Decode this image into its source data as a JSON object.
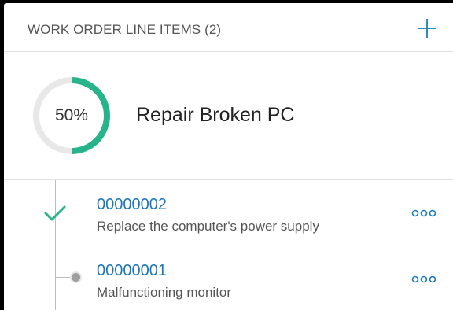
{
  "header": {
    "title": "WORK ORDER LINE ITEMS (2)",
    "add_icon": "plus-icon"
  },
  "summary": {
    "progress_label": "50%",
    "progress_fraction": 0.5,
    "title": "Repair Broken PC"
  },
  "items": [
    {
      "number": "00000002",
      "description": "Replace the computer's power supply",
      "status_icon": "check-icon",
      "more_icon": "more-icon"
    },
    {
      "number": "00000001",
      "description": "Malfunctioning monitor",
      "status_icon": "dot-icon",
      "more_icon": "more-icon"
    }
  ],
  "colors": {
    "accent": "#26b48a",
    "link": "#1b78b8",
    "ring_track": "#e8e8e8",
    "plus": "#2a8acb"
  }
}
